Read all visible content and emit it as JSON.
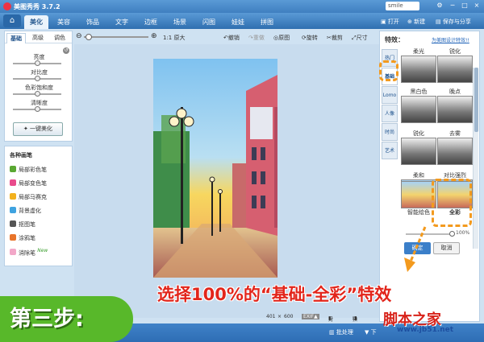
{
  "titlebar": {
    "title": "美图秀秀 3.7.2",
    "user": "smile",
    "min": "─",
    "max": "□",
    "close": "×"
  },
  "tabs": [
    "美化",
    "美容",
    "饰品",
    "文字",
    "边框",
    "场景",
    "闪图",
    "娃娃",
    "拼图"
  ],
  "top_actions": {
    "open": "打开",
    "new": "新建",
    "save": "保存与分享"
  },
  "left_panel": {
    "subtabs": [
      "基础",
      "高级",
      "调色"
    ],
    "sliders": [
      {
        "label": "亮度",
        "value": 0.5
      },
      {
        "label": "对比度",
        "value": 0.5
      },
      {
        "label": "色彩饱和度",
        "value": 0.5
      },
      {
        "label": "清晰度",
        "value": 0.5
      }
    ],
    "one_click": "一键美化"
  },
  "brush_panel": {
    "title": "各种画笔",
    "items": [
      {
        "label": "局部彩色笔",
        "color": "#5aa832"
      },
      {
        "label": "局部变色笔",
        "color": "#e94b8c"
      },
      {
        "label": "局部马赛克",
        "color": "#f3b11d"
      },
      {
        "label": "背景虚化",
        "color": "#3fa3e0"
      },
      {
        "label": "抠图笔",
        "color": "#555555"
      },
      {
        "label": "涂鸦笔",
        "color": "#e8742a"
      },
      {
        "label": "消除笔",
        "color": "#f2a7c8",
        "badge": "New"
      }
    ]
  },
  "toolbar": {
    "original_size": "1:1 原大",
    "undo": "撤销",
    "redo": "重做",
    "origin": "原图",
    "rotate": "旋转",
    "crop": "裁剪",
    "size": "尺寸"
  },
  "status_bar": {
    "width": "401",
    "x": "×",
    "height": "600",
    "exif": "EXIF▲",
    "compare": "对比",
    "preview": "预览"
  },
  "bottom_bar": {
    "batch": "批处理",
    "next": "下"
  },
  "right_panel": {
    "title": "特效：",
    "link": "为美图设计特效!!",
    "categories": [
      "热门",
      "基础",
      "Lomo",
      "人像",
      "时尚",
      "艺术"
    ],
    "effects": [
      {
        "label": "柔光"
      },
      {
        "label": "锐化"
      },
      {
        "label": "黑白色"
      },
      {
        "label": "晚点"
      },
      {
        "label": "锐化"
      },
      {
        "label": "去雾"
      },
      {
        "label": "柔和"
      },
      {
        "label": "对比强烈"
      },
      {
        "label": "智能绘色"
      },
      {
        "label": "全彩"
      }
    ],
    "intensity": 1.0,
    "intensity_label": "100%",
    "ok": "确定",
    "cancel": "取消"
  },
  "overlay": {
    "instruction": "选择100%的“基础-全彩”特效",
    "step": "第三步:",
    "watermark": "脚本之家",
    "watermark_url": "www.jb51.net"
  }
}
